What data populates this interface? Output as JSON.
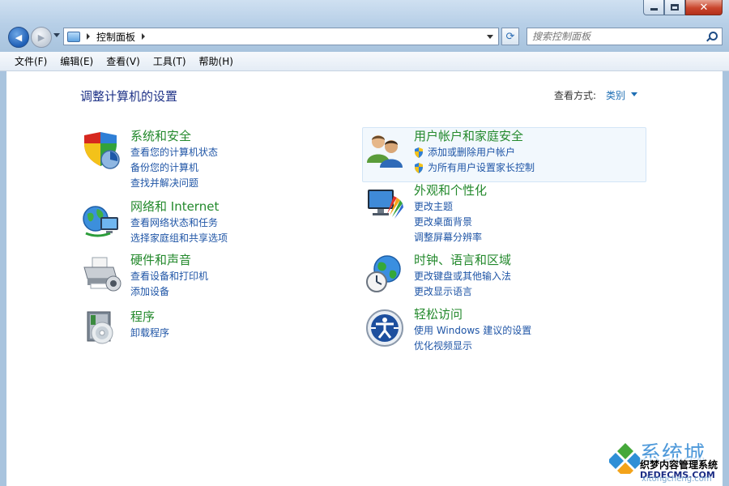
{
  "window": {
    "close_glyph": "✕"
  },
  "nav": {
    "back_glyph": "◀",
    "forward_glyph": "▶",
    "breadcrumb": "控制面板",
    "refresh_glyph": "⟳",
    "search_placeholder": "搜索控制面板"
  },
  "menu": [
    "文件(F)",
    "编辑(E)",
    "查看(V)",
    "工具(T)",
    "帮助(H)"
  ],
  "content": {
    "heading": "调整计算机的设置",
    "view_by_label": "查看方式:",
    "view_by_value": "类别"
  },
  "categories": [
    {
      "icon": "shield-icon",
      "title": "系统和安全",
      "links": [
        "查看您的计算机状态",
        "备份您的计算机",
        "查找并解决问题"
      ]
    },
    {
      "icon": "network-icon",
      "title": "网络和 Internet",
      "links": [
        "查看网络状态和任务",
        "选择家庭组和共享选项"
      ]
    },
    {
      "icon": "printer-icon",
      "title": "硬件和声音",
      "links": [
        "查看设备和打印机",
        "添加设备"
      ]
    },
    {
      "icon": "programs-icon",
      "title": "程序",
      "links": [
        "卸载程序"
      ]
    },
    {
      "icon": "users-icon",
      "title": "用户帐户和家庭安全",
      "links": [
        "添加或删除用户帐户",
        "为所有用户设置家长控制"
      ]
    },
    {
      "icon": "monitor-icon",
      "title": "外观和个性化",
      "links": [
        "更改主题",
        "更改桌面背景",
        "调整屏幕分辨率"
      ]
    },
    {
      "icon": "globe-clock-icon",
      "title": "时钟、语言和区域",
      "links": [
        "更改键盘或其他输入法",
        "更改显示语言"
      ]
    },
    {
      "icon": "ease-of-access-icon",
      "title": "轻松访问",
      "links": [
        "使用 Windows 建议的设置",
        "优化视频显示"
      ]
    }
  ],
  "watermark": {
    "brand": "系统城",
    "line2": "织梦内容管理系统",
    "line3": "DEDECMS.COM",
    "line4": "xitongcheng.com"
  },
  "colors": {
    "title_green": "#23892c",
    "link_blue": "#1f55a6",
    "heading_blue": "#1e3287"
  }
}
